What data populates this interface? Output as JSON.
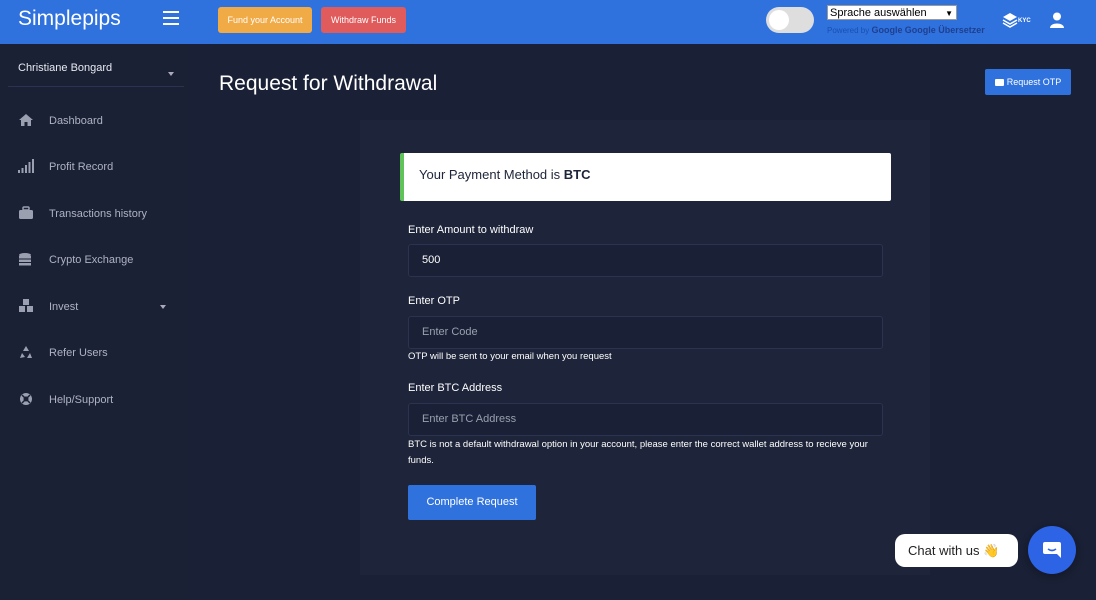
{
  "header": {
    "brand": "Simplepips",
    "fund_label": "Fund your Account",
    "withdraw_label": "Withdraw Funds",
    "language_select": "Sprache auswählen",
    "translate_powered": "Powered by",
    "translate_google": "Google",
    "translate_link": "Google Übersetzer",
    "kyc_label": "KYC"
  },
  "sidebar": {
    "user_name": "Christiane Bongard",
    "items": [
      {
        "label": "Dashboard",
        "icon": "home-icon"
      },
      {
        "label": "Profit Record",
        "icon": "signal-icon"
      },
      {
        "label": "Transactions history",
        "icon": "briefcase-icon"
      },
      {
        "label": "Crypto Exchange",
        "icon": "coins-icon"
      },
      {
        "label": "Invest",
        "icon": "cubes-icon"
      },
      {
        "label": "Refer Users",
        "icon": "recycle-icon"
      },
      {
        "label": "Help/Support",
        "icon": "lifebuoy-icon"
      }
    ]
  },
  "main": {
    "title": "Request for Withdrawal",
    "request_otp_label": "Request OTP",
    "payment_prefix": "Your Payment Method is ",
    "payment_method": "BTC",
    "amount_label": "Enter Amount to withdraw",
    "amount_value": "500",
    "otp_label": "Enter OTP",
    "otp_placeholder": "Enter Code",
    "otp_help": "OTP will be sent to your email when you request",
    "address_label": "Enter BTC Address",
    "address_placeholder": "Enter BTC Address",
    "address_help": "BTC is not a default withdrawal option in your account, please enter the correct wallet address to recieve your funds.",
    "submit_label": "Complete Request"
  },
  "chat": {
    "bubble_text": "Chat with us 👋"
  },
  "colors": {
    "topbar": "#2f72de",
    "background": "#1a2035",
    "fund_button": "#f0ab47",
    "withdraw_button": "#e05b5b",
    "accent_green": "#5fc35a"
  }
}
